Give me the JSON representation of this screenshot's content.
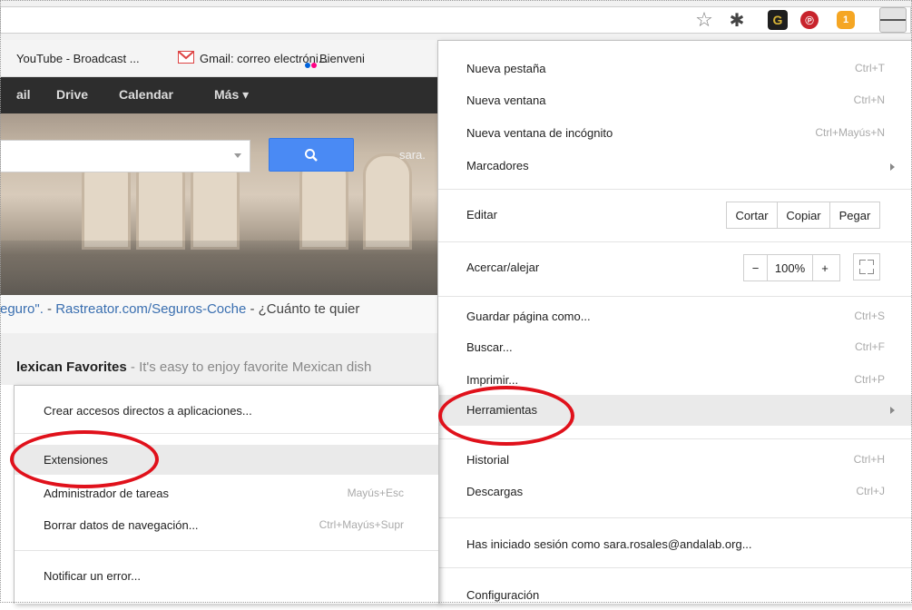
{
  "toolbar": {
    "extension_icons": [
      "star-icon",
      "bug-icon",
      "g-extension-icon",
      "pinterest-icon",
      "badge-one-icon",
      "menu-icon"
    ],
    "g_glyph": "G",
    "pin_glyph": "℗",
    "one_glyph": "1"
  },
  "bookmarks": [
    "YouTube - Broadcast ...",
    "Gmail: correo electróni...",
    "Bienveni"
  ],
  "google_bar": [
    "ail",
    "Drive",
    "Calendar",
    "Más ▾"
  ],
  "page": {
    "search_cut_user": "sara.",
    "ad_link": "eguro\".",
    "ad_sep": " - ",
    "ad_url": "Rastreator.com/Seguros-Coche",
    "ad_tail": " - ¿Cuánto te quier",
    "promo_title": "lexican Favorites",
    "promo_text": " - It's easy to enjoy favorite Mexican dish"
  },
  "main_menu": {
    "nueva_pestana": {
      "label": "Nueva pestaña",
      "shortcut": "Ctrl+T"
    },
    "nueva_ventana": {
      "label": "Nueva ventana",
      "shortcut": "Ctrl+N"
    },
    "incognito": {
      "label": "Nueva ventana de incógnito",
      "shortcut": "Ctrl+Mayús+N"
    },
    "marcadores": {
      "label": "Marcadores"
    },
    "editar": {
      "label": "Editar",
      "cortar": "Cortar",
      "copiar": "Copiar",
      "pegar": "Pegar"
    },
    "zoom": {
      "label": "Acercar/alejar",
      "minus": "−",
      "value": "100%",
      "plus": "+"
    },
    "guardar": {
      "label": "Guardar página como...",
      "shortcut": "Ctrl+S"
    },
    "buscar": {
      "label": "Buscar...",
      "shortcut": "Ctrl+F"
    },
    "imprimir": {
      "label": "Imprimir...",
      "shortcut": "Ctrl+P"
    },
    "herramientas": {
      "label": "Herramientas"
    },
    "historial": {
      "label": "Historial",
      "shortcut": "Ctrl+H"
    },
    "descargas": {
      "label": "Descargas",
      "shortcut": "Ctrl+J"
    },
    "sesion": {
      "label": "Has iniciado sesión como sara.rosales@andalab.org..."
    },
    "configuracion": {
      "label": "Configuración"
    }
  },
  "tools_menu": {
    "accesos": {
      "label": "Crear accesos directos a aplicaciones..."
    },
    "extensiones": {
      "label": "Extensiones"
    },
    "administrador": {
      "label": "Administrador de tareas",
      "shortcut": "Mayús+Esc"
    },
    "borrar": {
      "label": "Borrar datos de navegación...",
      "shortcut": "Ctrl+Mayús+Supr"
    },
    "notificar": {
      "label": "Notificar un error..."
    }
  },
  "colors": {
    "highlight_ring": "#e0111b",
    "search_button": "#4a8af4",
    "google_bar": "#2d2d2d",
    "link": "#1a0dab"
  }
}
